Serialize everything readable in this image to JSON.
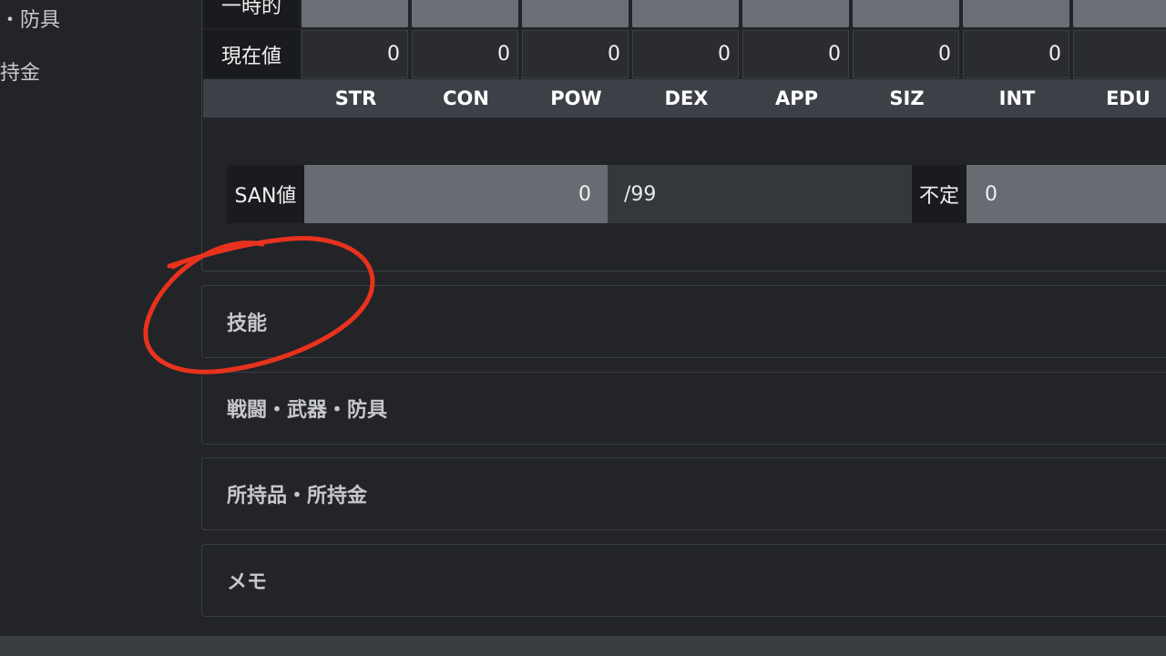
{
  "sidebar": {
    "items": [
      {
        "label": "・防具"
      },
      {
        "label": "持金"
      }
    ]
  },
  "stats": {
    "temp_label": "一時的",
    "current_label": "現在値",
    "headers": [
      "STR",
      "CON",
      "POW",
      "DEX",
      "APP",
      "SIZ",
      "INT",
      "EDU"
    ],
    "current_values": [
      "0",
      "0",
      "0",
      "0",
      "0",
      "0",
      "0"
    ]
  },
  "san": {
    "label": "SAN値",
    "value": "0",
    "max": "/99",
    "indefinite_label": "不定",
    "indefinite_value": "0"
  },
  "sections": [
    {
      "label": "技能"
    },
    {
      "label": "戦闘・武器・防具"
    },
    {
      "label": "所持品・所持金"
    },
    {
      "label": "メモ"
    }
  ],
  "colors": {
    "background": "#222427",
    "annotation": "#e8321e"
  }
}
